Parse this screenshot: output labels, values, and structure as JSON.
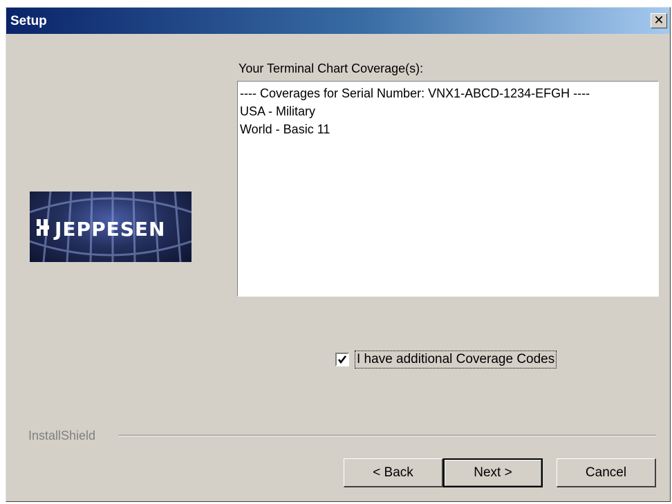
{
  "window": {
    "title": "Setup",
    "close_glyph": "✕"
  },
  "logo": {
    "text": "JEPPESEN",
    "icon": "jeppesen-logo"
  },
  "coverage": {
    "label": "Your Terminal Chart Coverage(s):",
    "lines": [
      "---- Coverages for Serial Number: VNX1-ABCD-1234-EFGH ----",
      "USA - Military",
      "World - Basic 11"
    ]
  },
  "additional_codes": {
    "label": "I have additional Coverage Codes",
    "checked": true
  },
  "footer": {
    "brand": "InstallShield"
  },
  "buttons": {
    "back": "< Back",
    "next": "Next >",
    "cancel": "Cancel"
  },
  "colors": {
    "titlebar_start": "#0a246a",
    "titlebar_end": "#a6caf0",
    "dialog_face": "#d4d0c8"
  }
}
